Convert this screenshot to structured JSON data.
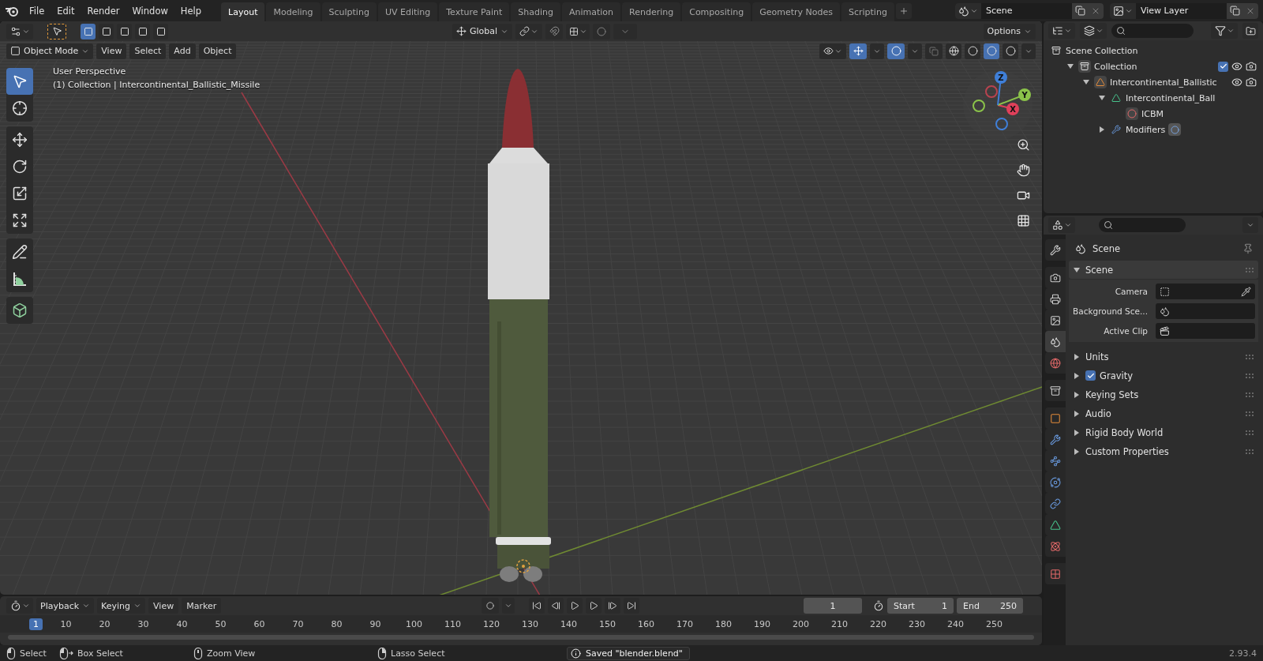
{
  "top_bar": {
    "menus": [
      "File",
      "Edit",
      "Render",
      "Window",
      "Help"
    ],
    "workspaces": [
      {
        "label": "Layout",
        "selected": true
      },
      {
        "label": "Modeling",
        "selected": false
      },
      {
        "label": "Sculpting",
        "selected": false
      },
      {
        "label": "UV Editing",
        "selected": false
      },
      {
        "label": "Texture Paint",
        "selected": false
      },
      {
        "label": "Shading",
        "selected": false
      },
      {
        "label": "Animation",
        "selected": false
      },
      {
        "label": "Rendering",
        "selected": false
      },
      {
        "label": "Compositing",
        "selected": false
      },
      {
        "label": "Geometry Nodes",
        "selected": false
      },
      {
        "label": "Scripting",
        "selected": false
      }
    ],
    "scene": "Scene",
    "view_layer": "View Layer"
  },
  "tool_header": {
    "select_modes": [
      {
        "selected": true
      },
      {
        "selected": false
      },
      {
        "selected": false
      },
      {
        "selected": false
      },
      {
        "selected": false
      }
    ],
    "orientation": "Global",
    "options": "Options"
  },
  "viewport_header": {
    "mode": "Object Mode",
    "menus": [
      "View",
      "Select",
      "Add",
      "Object"
    ],
    "shading_modes": [
      {
        "selected": false
      },
      {
        "selected": false
      },
      {
        "selected": true
      },
      {
        "selected": false
      }
    ]
  },
  "viewport": {
    "perspective": "User Perspective",
    "object_info": "(1) Collection | Intercontinental_Ballistic_Missile",
    "tool_groups": [
      [
        {
          "kind": "select",
          "selected": true
        },
        {
          "kind": "cursor",
          "selected": false
        }
      ],
      [
        {
          "kind": "move",
          "selected": false
        },
        {
          "kind": "rotate",
          "selected": false
        },
        {
          "kind": "scale",
          "selected": false
        },
        {
          "kind": "transform",
          "selected": false
        }
      ],
      [
        {
          "kind": "annotate",
          "selected": false
        },
        {
          "kind": "measure",
          "selected": false
        }
      ],
      [
        {
          "kind": "add-cube",
          "selected": false
        }
      ]
    ],
    "gizmo_axes": [
      "X",
      "Y",
      "Z"
    ]
  },
  "outliner": {
    "tree": [
      {
        "label": "Scene Collection",
        "kind": "scene-collection",
        "children": [
          {
            "label": "Collection",
            "kind": "collection",
            "expanded": true,
            "checked": true,
            "visible": true,
            "renderable": true,
            "children": [
              {
                "label": "Intercontinental_Ballistic",
                "kind": "object",
                "expanded": true,
                "visible": true,
                "renderable": true,
                "children": [
                  {
                    "label": "Intercontinental_Ball",
                    "kind": "mesh",
                    "expanded": true,
                    "children": [
                      {
                        "label": "ICBM",
                        "kind": "material"
                      }
                    ]
                  },
                  {
                    "label": "Modifiers",
                    "kind": "modifiers",
                    "expanded": false
                  }
                ]
              }
            ]
          }
        ]
      }
    ]
  },
  "properties": {
    "context": "Scene",
    "tab_groups": [
      [
        {
          "kind": "tool",
          "selected": false
        }
      ],
      [
        {
          "kind": "render",
          "selected": false
        },
        {
          "kind": "output",
          "selected": false
        },
        {
          "kind": "view-layer",
          "selected": false
        },
        {
          "kind": "scene",
          "selected": true
        },
        {
          "kind": "world",
          "selected": false
        }
      ],
      [
        {
          "kind": "collection",
          "selected": false
        }
      ],
      [
        {
          "kind": "object",
          "selected": false
        },
        {
          "kind": "modifiers",
          "selected": false
        },
        {
          "kind": "particles",
          "selected": false
        },
        {
          "kind": "physics",
          "selected": false
        },
        {
          "kind": "constraints",
          "selected": false
        },
        {
          "kind": "data",
          "selected": false
        },
        {
          "kind": "material",
          "selected": false
        }
      ],
      [
        {
          "kind": "texture",
          "selected": false
        }
      ]
    ],
    "panels": [
      {
        "title": "Scene",
        "expanded": true,
        "fields": [
          {
            "label": "Camera",
            "kind": "camera"
          },
          {
            "label": "Background Sce...",
            "kind": "scene"
          },
          {
            "label": "Active Clip",
            "kind": "clip"
          }
        ]
      },
      {
        "title": "Units",
        "expanded": false
      },
      {
        "title": "Gravity",
        "expanded": false,
        "checked": true
      },
      {
        "title": "Keying Sets",
        "expanded": false
      },
      {
        "title": "Audio",
        "expanded": false
      },
      {
        "title": "Rigid Body World",
        "expanded": false
      },
      {
        "title": "Custom Properties",
        "expanded": false
      }
    ]
  },
  "timeline": {
    "dropdowns": [
      "Playback",
      "Keying"
    ],
    "menus": [
      "View",
      "Marker"
    ],
    "current_frame": "1",
    "start_label": "Start",
    "start": "1",
    "end_label": "End",
    "end": "250",
    "ruler": [
      {
        "label": "1",
        "selected": true
      },
      {
        "label": "10",
        "selected": false
      },
      {
        "label": "20",
        "selected": false
      },
      {
        "label": "30",
        "selected": false
      },
      {
        "label": "40",
        "selected": false
      },
      {
        "label": "50",
        "selected": false
      },
      {
        "label": "60",
        "selected": false
      },
      {
        "label": "70",
        "selected": false
      },
      {
        "label": "80",
        "selected": false
      },
      {
        "label": "90",
        "selected": false
      },
      {
        "label": "100",
        "selected": false
      },
      {
        "label": "110",
        "selected": false
      },
      {
        "label": "120",
        "selected": false
      },
      {
        "label": "130",
        "selected": false
      },
      {
        "label": "140",
        "selected": false
      },
      {
        "label": "150",
        "selected": false
      },
      {
        "label": "160",
        "selected": false
      },
      {
        "label": "170",
        "selected": false
      },
      {
        "label": "180",
        "selected": false
      },
      {
        "label": "190",
        "selected": false
      },
      {
        "label": "200",
        "selected": false
      },
      {
        "label": "210",
        "selected": false
      },
      {
        "label": "220",
        "selected": false
      },
      {
        "label": "230",
        "selected": false
      },
      {
        "label": "240",
        "selected": false
      },
      {
        "label": "250",
        "selected": false
      }
    ]
  },
  "status_bar": {
    "hints": [
      {
        "label": "Select",
        "kind": "left"
      },
      {
        "label": "Box Select",
        "kind": "left-drag"
      },
      {
        "label": "Zoom View",
        "kind": "middle"
      },
      {
        "label": "Lasso Select",
        "kind": "right"
      }
    ],
    "message": "Saved \"blender.blend\"",
    "version": "2.93.4"
  }
}
